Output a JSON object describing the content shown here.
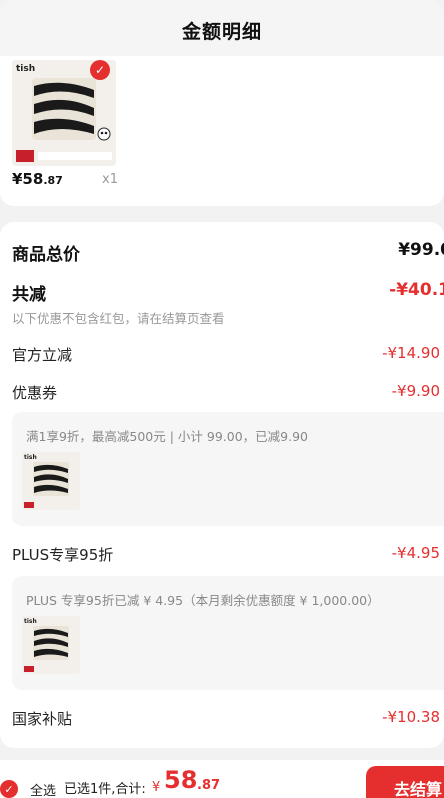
{
  "header": {
    "title": "金额明细"
  },
  "product": {
    "price_int": "¥58",
    "price_dec": ".87",
    "quantity": "x1"
  },
  "detail": {
    "goods_total_label": "商品总价",
    "goods_total_value": "¥99.0",
    "total_discount_label": "共减",
    "total_discount_value": "-¥40.1",
    "discount_note": "以下优惠不包含红包，请在结算页查看",
    "official_label": "官方立减",
    "official_value": "-¥14.90",
    "coupon_label": "优惠券",
    "coupon_value": "-¥9.90",
    "coupon_desc": "满1享9折，最高减500元 | 小计 99.00，已减9.90",
    "plus_label": "PLUS专享95折",
    "plus_value": "-¥4.95",
    "plus_desc": "PLUS 专享95折已减 ¥ 4.95（本月剩余优惠额度 ¥ 1,000.00）",
    "subsidy_label": "国家补贴",
    "subsidy_value": "-¥10.38"
  },
  "bottom": {
    "select_all": "全选",
    "summary": "已选1件,合计:",
    "currency": "¥",
    "total_int": "58",
    "total_dec": ".87",
    "checkout": "去结算"
  },
  "colors": {
    "accent": "#e52f2f",
    "muted": "#999999"
  }
}
